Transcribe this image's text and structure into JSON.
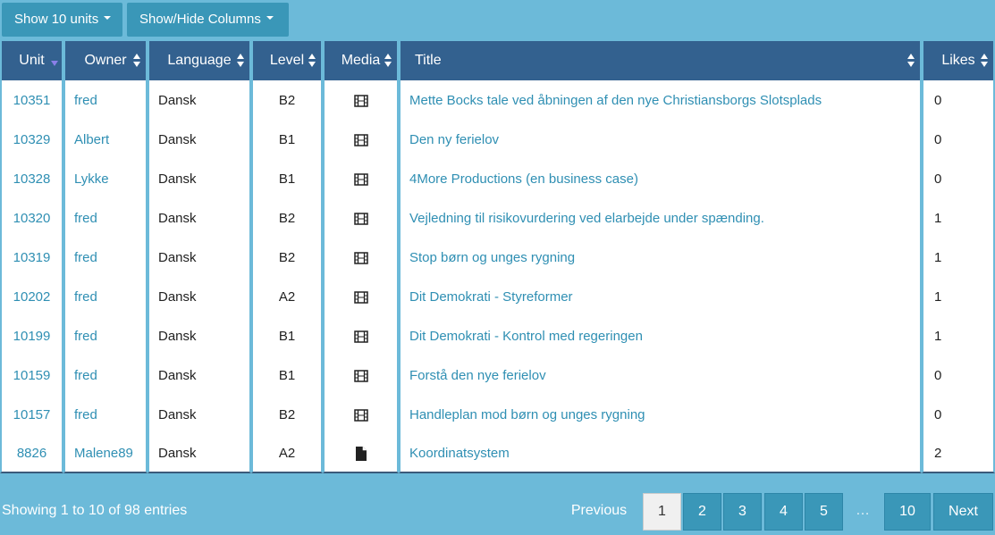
{
  "toolbar": {
    "show_units_label": "Show 10 units",
    "show_hide_columns_label": "Show/Hide Columns"
  },
  "table": {
    "columns": [
      "Unit",
      "Owner",
      "Language",
      "Level",
      "Media",
      "Title",
      "Likes"
    ],
    "sorted_column": "Unit",
    "sort_direction": "descending",
    "rows": [
      {
        "unit": "10351",
        "owner": "fred",
        "language": "Dansk",
        "level": "B2",
        "media": "film-icon",
        "title": "Mette Bocks tale ved åbningen af den nye Christiansborgs Slotsplads",
        "likes": "0"
      },
      {
        "unit": "10329",
        "owner": "Albert",
        "language": "Dansk",
        "level": "B1",
        "media": "film-icon",
        "title": "Den ny ferielov",
        "likes": "0"
      },
      {
        "unit": "10328",
        "owner": "Lykke",
        "language": "Dansk",
        "level": "B1",
        "media": "film-icon",
        "title": "4More Productions (en business case)",
        "likes": "0"
      },
      {
        "unit": "10320",
        "owner": "fred",
        "language": "Dansk",
        "level": "B2",
        "media": "film-icon",
        "title": "Vejledning til risikovurdering ved elarbejde under spænding.",
        "likes": "1"
      },
      {
        "unit": "10319",
        "owner": "fred",
        "language": "Dansk",
        "level": "B2",
        "media": "film-icon",
        "title": "Stop børn og unges rygning",
        "likes": "1"
      },
      {
        "unit": "10202",
        "owner": "fred",
        "language": "Dansk",
        "level": "A2",
        "media": "film-icon",
        "title": "Dit Demokrati - Styreformer",
        "likes": "1"
      },
      {
        "unit": "10199",
        "owner": "fred",
        "language": "Dansk",
        "level": "B1",
        "media": "film-icon",
        "title": "Dit Demokrati - Kontrol med regeringen",
        "likes": "1"
      },
      {
        "unit": "10159",
        "owner": "fred",
        "language": "Dansk",
        "level": "B1",
        "media": "film-icon",
        "title": "Forstå den nye ferielov",
        "likes": "0"
      },
      {
        "unit": "10157",
        "owner": "fred",
        "language": "Dansk",
        "level": "B2",
        "media": "film-icon",
        "title": "Handleplan mod børn og unges rygning",
        "likes": "0"
      },
      {
        "unit": "8826",
        "owner": "Malene89",
        "language": "Dansk",
        "level": "A2",
        "media": "document-icon",
        "title": "Koordinatsystem",
        "likes": "2"
      }
    ]
  },
  "footer": {
    "info": "Showing 1 to 10 of 98 entries",
    "pagination": {
      "previous": "Previous",
      "pages": [
        "1",
        "2",
        "3",
        "4",
        "5"
      ],
      "ellipsis": "…",
      "last": "10",
      "next": "Next",
      "current": "1"
    }
  },
  "colors": {
    "background": "#6cbad9",
    "header": "#33618f",
    "link": "#2f8fb3",
    "button": "#3a97b8"
  }
}
